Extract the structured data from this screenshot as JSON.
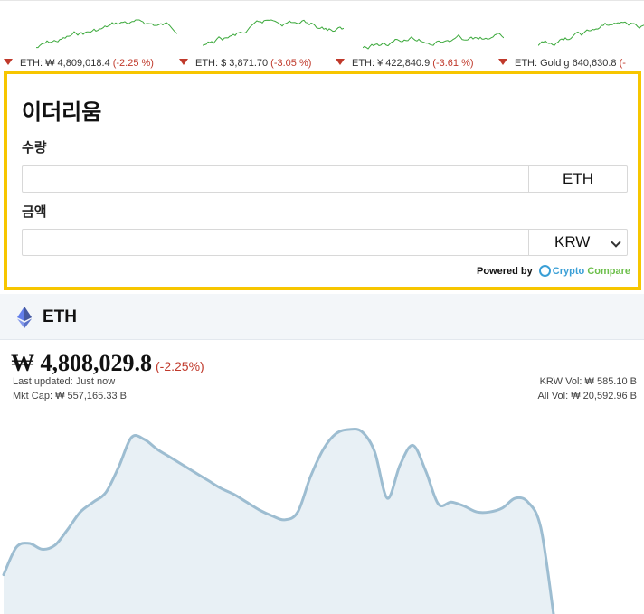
{
  "ticker": [
    {
      "label": "ETH: ₩ 4,809,018.4",
      "change": "(-2.25 %)"
    },
    {
      "label": "ETH: $ 3,871.70",
      "change": "(-3.05 %)"
    },
    {
      "label": "ETH: ¥ 422,840.9",
      "change": "(-3.61 %)"
    },
    {
      "label": "ETH: Gold g 640,630.8",
      "change": "(-"
    }
  ],
  "converter": {
    "title": "이더리움",
    "amount_label": "수량",
    "amount_value": "",
    "amount_unit": "ETH",
    "price_label": "금액",
    "price_value": "",
    "price_currency": "KRW",
    "powered_by": "Powered by",
    "brand_part1": "Crypto",
    "brand_part2": "Compare"
  },
  "coin": {
    "symbol": "ETH",
    "price": "₩ 4,808,029.8",
    "change": "(-2.25%)",
    "last_updated": "Last updated: Just now",
    "mkt_cap": "Mkt Cap: ₩ 557,165.33 B",
    "krw_vol": "KRW Vol: ₩ 585.10 B",
    "all_vol": "All Vol: ₩ 20,592.96 B"
  },
  "colors": {
    "accent_border": "#f7c600",
    "negative": "#c0392b",
    "sparkline": "#3aa83a",
    "chart_line": "#9dbdd1",
    "chart_fill": "#e8f0f5"
  },
  "chart_data": {
    "type": "area",
    "title": "",
    "xlabel": "",
    "ylabel": "",
    "ylim": [
      0,
      100
    ],
    "values": [
      20,
      34,
      36,
      33,
      35,
      43,
      52,
      57,
      62,
      75,
      90,
      89,
      84,
      80,
      76,
      72,
      68,
      64,
      61,
      57,
      53,
      50,
      48,
      52,
      70,
      84,
      92,
      94,
      93,
      83,
      59,
      76,
      86,
      73,
      56,
      57,
      55,
      52,
      52,
      54,
      59,
      57,
      44,
      0
    ]
  }
}
